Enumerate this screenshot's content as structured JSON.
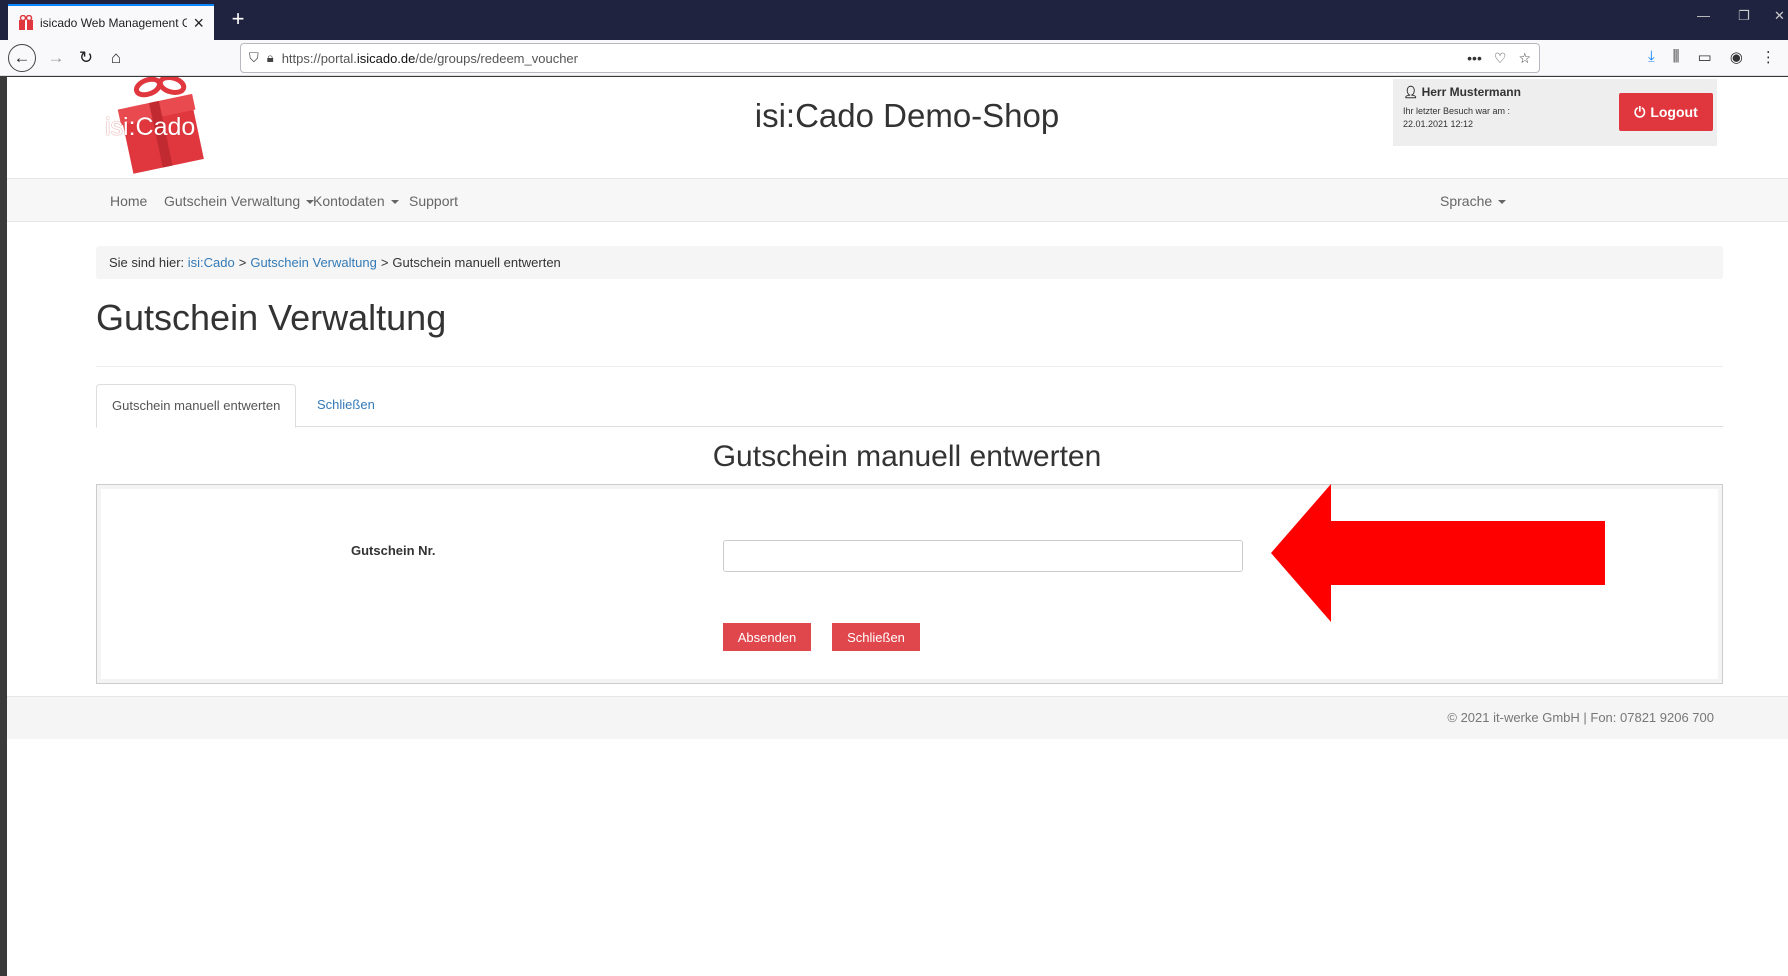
{
  "browser": {
    "tab_title": "isicado Web Management Gut",
    "url_prefix": "https://portal.",
    "url_domain": "isicado.de",
    "url_path": "/de/groups/redeem_voucher",
    "new_tab": "+"
  },
  "header": {
    "logo_text": "isi:Cado",
    "site_title": "isi:Cado Demo-Shop",
    "user_name": "Herr Mustermann",
    "last_visit_label": "Ihr letzter Besuch war am :",
    "last_visit_value": "22.01.2021 12:12",
    "logout_label": "Logout"
  },
  "nav": {
    "home": "Home",
    "voucher_admin": "Gutschein Verwaltung",
    "account": "Kontodaten",
    "support": "Support",
    "language": "Sprache"
  },
  "breadcrumb": {
    "prefix": "Sie sind hier:",
    "crumb1": "isi:Cado",
    "sep": ">",
    "crumb2": "Gutschein Verwaltung",
    "current": "Gutschein manuell entwerten"
  },
  "main": {
    "heading": "Gutschein Verwaltung",
    "tab_active": "Gutschein manuell entwerten",
    "tab_close": "Schließen",
    "form_title": "Gutschein manuell entwerten",
    "field_label": "Gutschein Nr.",
    "field_value": "",
    "submit_label": "Absenden",
    "close_label": "Schließen"
  },
  "footer": {
    "text": "© 2021 it-werke GmbH | Fon: 07821 9206 700"
  },
  "colors": {
    "accent_red": "#e0373f",
    "arrow_red": "#ff0000",
    "link_blue": "#337ab7",
    "tabbar_bg": "#202340"
  }
}
